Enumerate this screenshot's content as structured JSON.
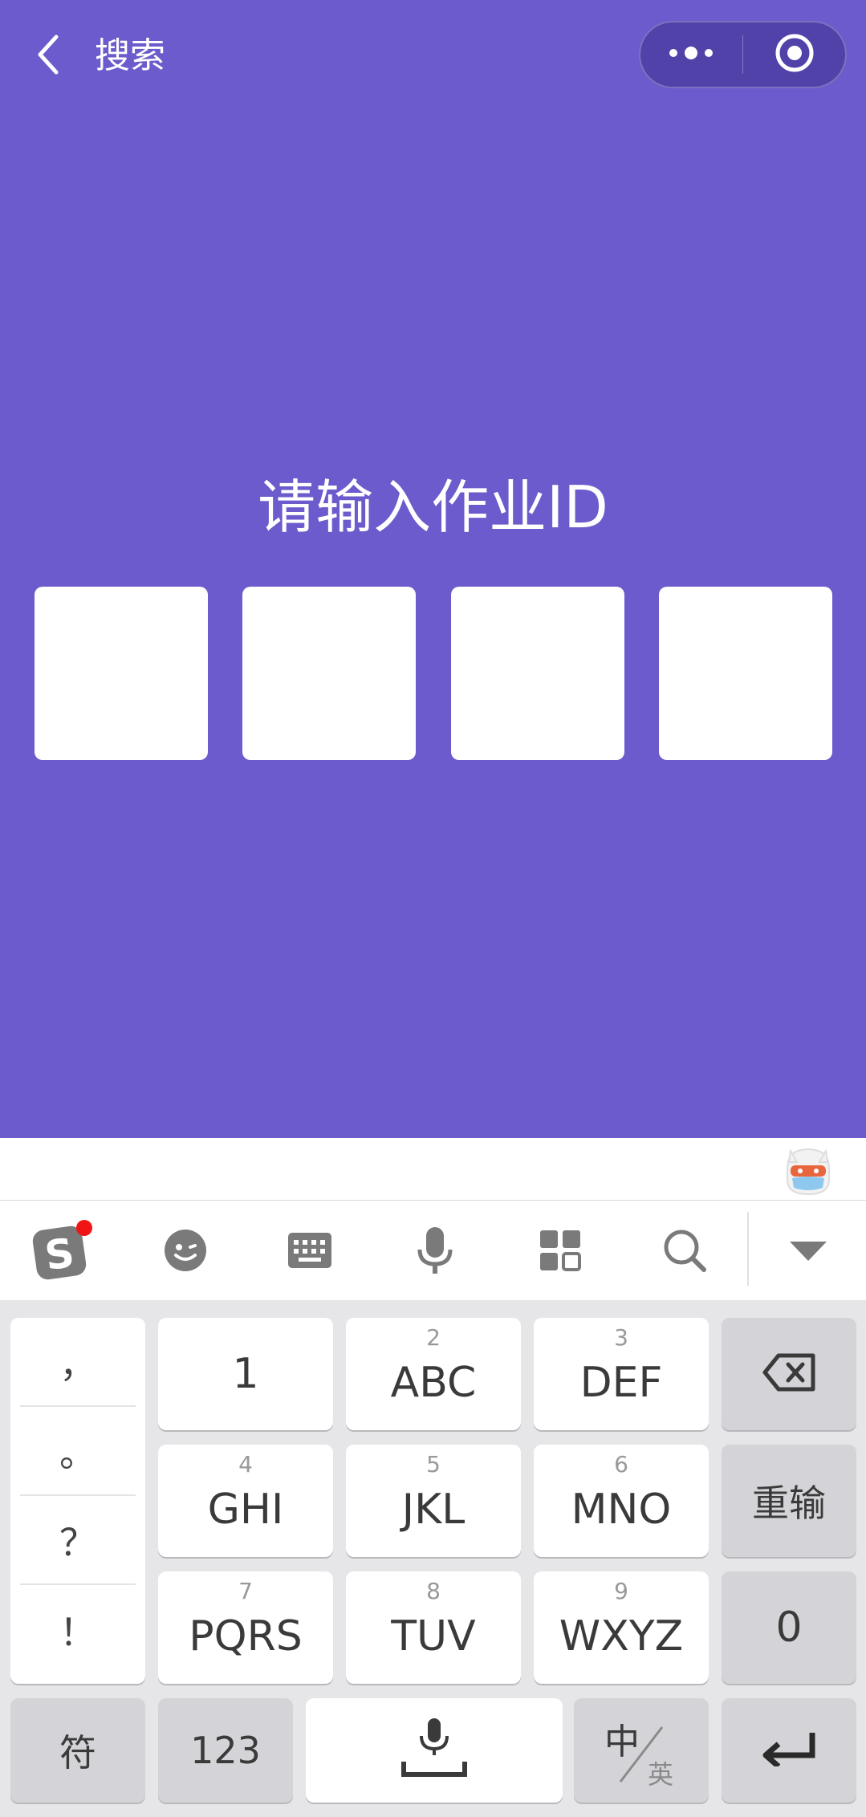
{
  "nav": {
    "title": "搜索",
    "back_icon": "chevron-left-icon",
    "more_icon": "more-dots-icon",
    "close_icon": "target-circle-icon"
  },
  "main": {
    "prompt": "请输入作业ID",
    "id_boxes": [
      "",
      "",
      "",
      ""
    ]
  },
  "colors": {
    "background": "#6b5bcc",
    "box": "#ffffff",
    "keyboard": "#e6e6e8"
  },
  "keyboard": {
    "toolbar_icons": [
      "sogou-logo-icon",
      "emoji-icon",
      "keyboard-icon",
      "microphone-icon",
      "apps-grid-icon",
      "search-icon",
      "collapse-triangle-icon"
    ],
    "punctuation": [
      "，",
      "。",
      "？",
      "！"
    ],
    "row1": [
      {
        "sup": "",
        "main": "1"
      },
      {
        "sup": "2",
        "main": "ABC"
      },
      {
        "sup": "3",
        "main": "DEF"
      }
    ],
    "row2": [
      {
        "sup": "4",
        "main": "GHI"
      },
      {
        "sup": "5",
        "main": "JKL"
      },
      {
        "sup": "6",
        "main": "MNO"
      }
    ],
    "row3": [
      {
        "sup": "7",
        "main": "PQRS"
      },
      {
        "sup": "8",
        "main": "TUV"
      },
      {
        "sup": "9",
        "main": "WXYZ"
      }
    ],
    "reinput": "重输",
    "zero": "0",
    "symbols": "符",
    "numbers": "123",
    "lang_zh": "中",
    "lang_en": "英"
  }
}
